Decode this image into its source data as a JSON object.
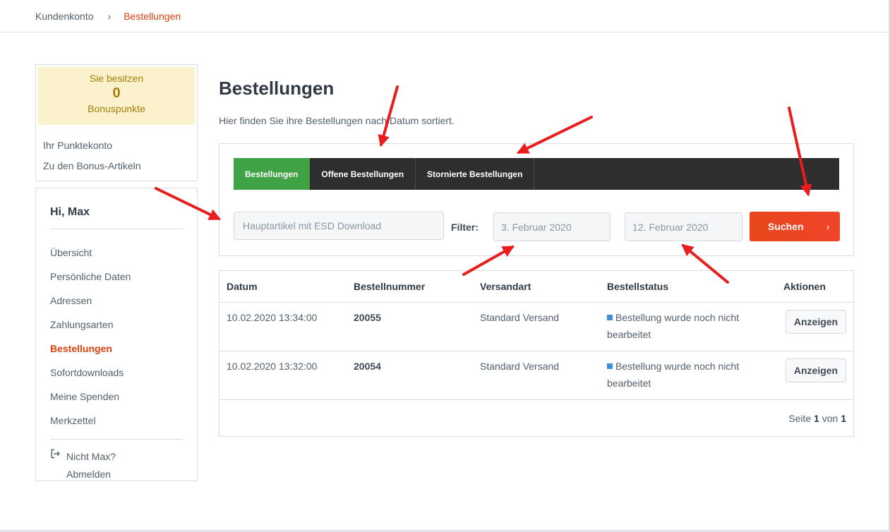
{
  "breadcrumb": {
    "home": "Kundenkonto",
    "separator": "›",
    "current": "Bestellungen"
  },
  "bonus": {
    "intro": "Sie besitzen",
    "points": "0",
    "unit": "Bonuspunkte",
    "links": [
      "Ihr Punktekonto",
      "Zu den Bonus-Artikeln"
    ]
  },
  "account_nav": {
    "greeting": "Hi, Max",
    "items": [
      "Übersicht",
      "Persönliche Daten",
      "Adressen",
      "Zahlungsarten",
      "Bestellungen",
      "Sofortdownloads",
      "Meine Spenden",
      "Merkzettel"
    ],
    "active_item": "Bestellungen",
    "logout_line1": "Nicht Max?",
    "logout_line2": "Abmelden"
  },
  "main": {
    "title": "Bestellungen",
    "intro": "Hier finden Sie ihre Bestellungen nach Datum sortiert."
  },
  "tabs": [
    "Bestellungen",
    "Offene Bestellungen",
    "Stornierte Bestellungen"
  ],
  "filter": {
    "search_placeholder": "Hauptartikel mit ESD Download",
    "label": "Filter:",
    "date_from": "3. Februar 2020",
    "date_to": "12. Februar 2020",
    "search_button": "Suchen"
  },
  "table": {
    "headers": [
      "Datum",
      "Bestellnummer",
      "Versandart",
      "Bestellstatus",
      "Aktionen"
    ],
    "rows": [
      {
        "date": "10.02.2020 13:34:00",
        "number": "20055",
        "shipping": "Standard Versand",
        "status": "Bestellung wurde noch nicht bearbeitet",
        "action": "Anzeigen"
      },
      {
        "date": "10.02.2020 13:32:00",
        "number": "20054",
        "shipping": "Standard Versand",
        "status": "Bestellung wurde noch nicht bearbeitet",
        "action": "Anzeigen"
      }
    ]
  },
  "pagination": {
    "page_label": "Seite",
    "current": "1",
    "of_label": "von",
    "total": "1"
  },
  "colors": {
    "accent": "#d9400e",
    "tab_active": "#3fa244",
    "tab_bar": "#2e2e2e",
    "search_button": "#e8461c",
    "bonus_bg": "#fbf2cd",
    "status_dot": "#3e8fd8",
    "annotation_arrow": "#e81d1d"
  }
}
